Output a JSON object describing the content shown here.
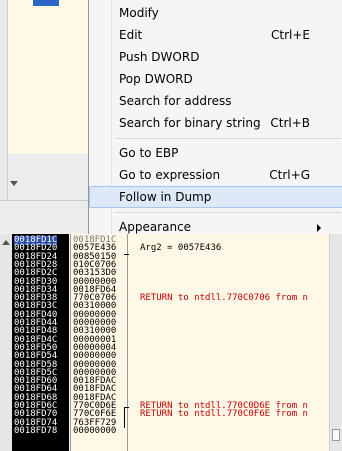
{
  "menu": {
    "items": [
      {
        "label": "Modify",
        "shortcut": ""
      },
      {
        "label": "Edit",
        "shortcut": "Ctrl+E"
      },
      {
        "label": "Push DWORD",
        "shortcut": ""
      },
      {
        "label": "Pop DWORD",
        "shortcut": ""
      },
      {
        "label": "Search for address",
        "shortcut": ""
      },
      {
        "label": "Search for binary string",
        "shortcut": "Ctrl+B"
      },
      {
        "label": "Go to EBP",
        "shortcut": ""
      },
      {
        "label": "Go to expression",
        "shortcut": "Ctrl+G"
      },
      {
        "label": "Follow in Dump",
        "shortcut": ""
      },
      {
        "label": "Appearance",
        "shortcut": ""
      }
    ],
    "highlighted": "Follow in Dump"
  },
  "stack": {
    "rows": [
      {
        "addr": "0018FD1C",
        "value": "0018FD1C",
        "comment": ""
      },
      {
        "addr": "0018FD20",
        "value": "0057E436",
        "comment": "Arg2 = 0057E436"
      },
      {
        "addr": "0018FD24",
        "value": "00850150",
        "comment": ""
      },
      {
        "addr": "0018FD28",
        "value": "010C0706",
        "comment": ""
      },
      {
        "addr": "0018FD2C",
        "value": "003153D0",
        "comment": ""
      },
      {
        "addr": "0018FD30",
        "value": "00000000",
        "comment": ""
      },
      {
        "addr": "0018FD34",
        "value": "0018FD64",
        "comment": ""
      },
      {
        "addr": "0018FD38",
        "value": "770C0706",
        "comment": "RETURN to ntdll.770C0706 from n"
      },
      {
        "addr": "0018FD3C",
        "value": "00310000",
        "comment": ""
      },
      {
        "addr": "0018FD40",
        "value": "00000000",
        "comment": ""
      },
      {
        "addr": "0018FD44",
        "value": "00000000",
        "comment": ""
      },
      {
        "addr": "0018FD48",
        "value": "00310000",
        "comment": ""
      },
      {
        "addr": "0018FD4C",
        "value": "00000001",
        "comment": ""
      },
      {
        "addr": "0018FD50",
        "value": "00000004",
        "comment": ""
      },
      {
        "addr": "0018FD54",
        "value": "00000000",
        "comment": ""
      },
      {
        "addr": "0018FD58",
        "value": "00000000",
        "comment": ""
      },
      {
        "addr": "0018FD5C",
        "value": "00000000",
        "comment": ""
      },
      {
        "addr": "0018FD60",
        "value": "0018FDAC",
        "comment": ""
      },
      {
        "addr": "0018FD64",
        "value": "0018FDAC",
        "comment": ""
      },
      {
        "addr": "0018FD68",
        "value": "0018FDAC",
        "comment": ""
      },
      {
        "addr": "0018FD6C",
        "value": "770C0D6E",
        "comment": "RETURN to ntdll.770C0D6E from n"
      },
      {
        "addr": "0018FD70",
        "value": "770C0F6E",
        "comment": "RETURN to ntdll.770C0F6E from n"
      },
      {
        "addr": "0018FD74",
        "value": "763FF729",
        "comment": ""
      },
      {
        "addr": "0018FD78",
        "value": "00000000",
        "comment": ""
      }
    ]
  },
  "colors": {
    "menu_highlight": "#dde9f7",
    "return_text": "#c00000",
    "pane_background": "#fff8e6",
    "address_column": "#000000"
  }
}
